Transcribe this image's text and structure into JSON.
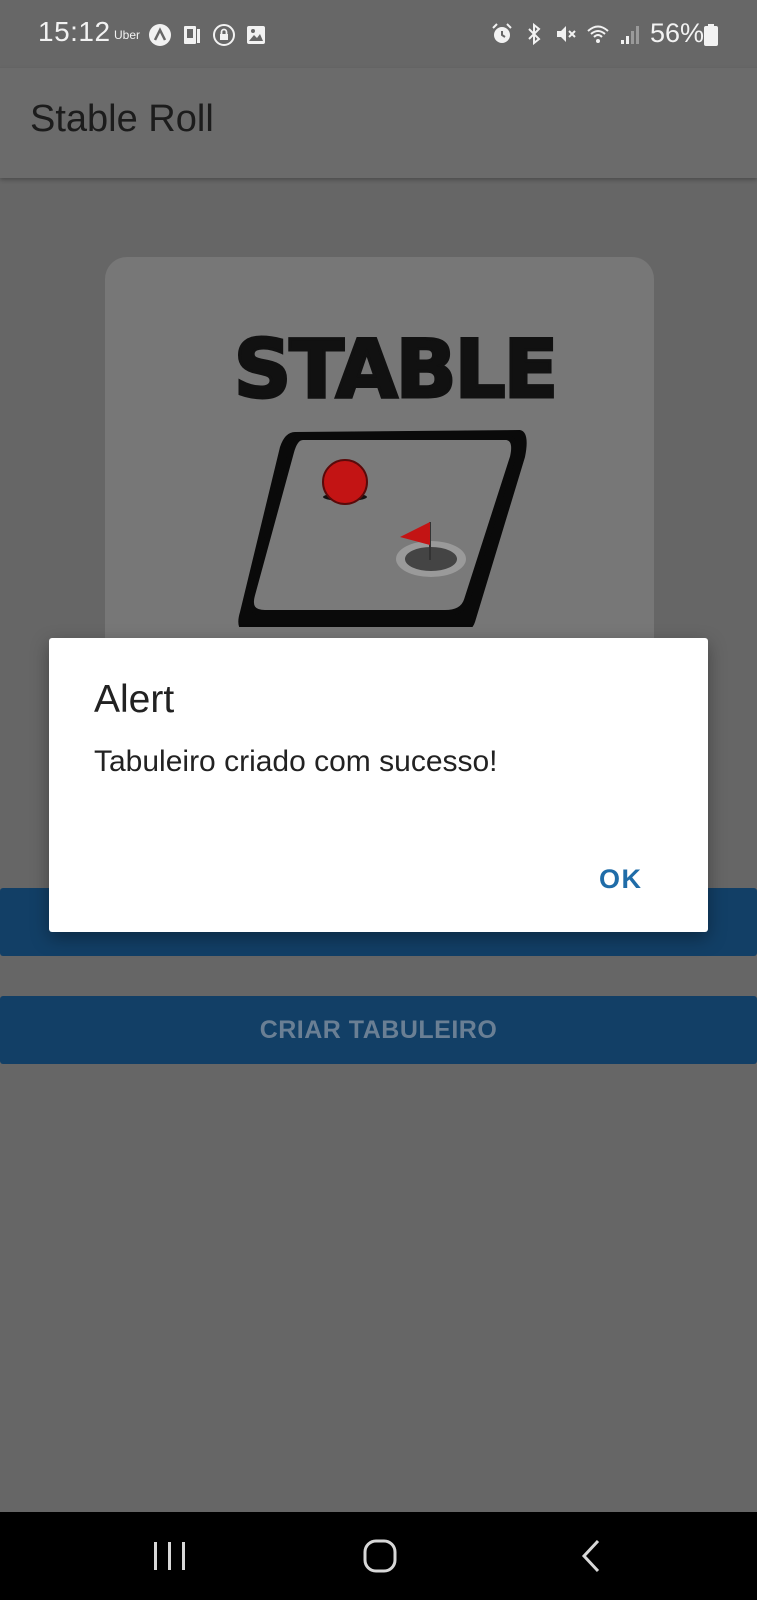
{
  "status_bar": {
    "time": "15:12",
    "uber_label": "Uber",
    "battery": "56%",
    "left_icons": [
      "assistant-icon",
      "phone-icon",
      "lock-app-icon",
      "image-icon"
    ],
    "right_icons": [
      "alarm-icon",
      "bluetooth-icon",
      "mute-icon",
      "wifi-icon",
      "signal-icon",
      "battery-icon"
    ]
  },
  "app_bar": {
    "title": "Stable Roll"
  },
  "logo": {
    "text": "STABLE",
    "ball_color": "#c31414",
    "flag_color": "#c31414"
  },
  "buttons": {
    "criar_label": "CRIAR TABULEIRO",
    "top_label": ""
  },
  "dialog": {
    "title": "Alert",
    "message": "Tabuleiro criado com sucesso!",
    "ok_label": "OK"
  },
  "colors": {
    "accent": "#1f6ca8",
    "button_bg": "#123f66",
    "overlay_bg": "#666666"
  },
  "nav_bar": {
    "icons": [
      "recents-icon",
      "home-icon",
      "back-icon"
    ]
  }
}
